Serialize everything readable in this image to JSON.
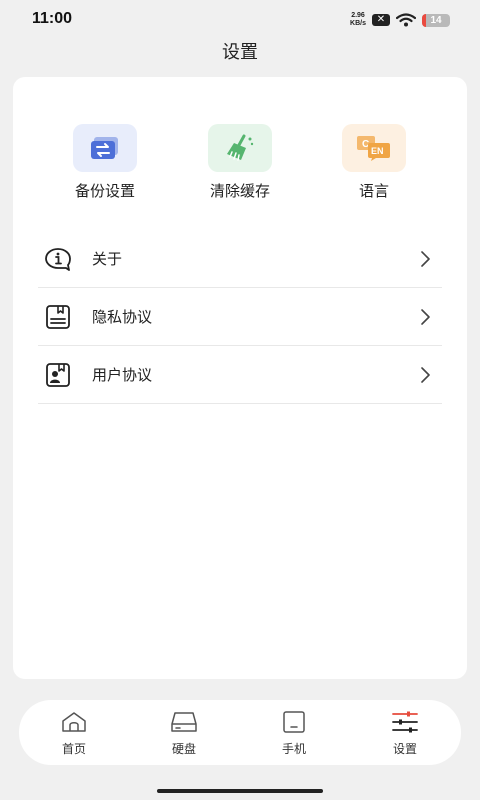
{
  "status_bar": {
    "time": "11:00",
    "net_speed_value": "2.96",
    "net_speed_unit": "KB/s",
    "battery_level": "14",
    "battery_fraction": 0.14,
    "battery_color": "#ea4a3f"
  },
  "header": {
    "title": "设置"
  },
  "quick_actions": [
    {
      "label": "备份设置",
      "icon": "backup-icon",
      "bg": "#e8edfb",
      "accent": "#4d6fd8"
    },
    {
      "label": "清除缓存",
      "icon": "broom-icon",
      "bg": "#e6f5ea",
      "accent": "#56b56f"
    },
    {
      "label": "语言",
      "icon": "language-icon",
      "bg": "#fdf0e1",
      "accent": "#f0a545",
      "icon_text_1": "C",
      "icon_text_2": "EN"
    }
  ],
  "menu": [
    {
      "label": "关于",
      "icon": "info-icon"
    },
    {
      "label": "隐私协议",
      "icon": "privacy-doc-icon"
    },
    {
      "label": "用户协议",
      "icon": "user-agreement-icon"
    }
  ],
  "bottom_nav": [
    {
      "label": "首页",
      "icon": "home-icon",
      "active": false
    },
    {
      "label": "硬盘",
      "icon": "drive-icon",
      "active": false
    },
    {
      "label": "手机",
      "icon": "phone-icon",
      "active": false
    },
    {
      "label": "设置",
      "icon": "settings-sliders-icon",
      "active": true
    }
  ]
}
